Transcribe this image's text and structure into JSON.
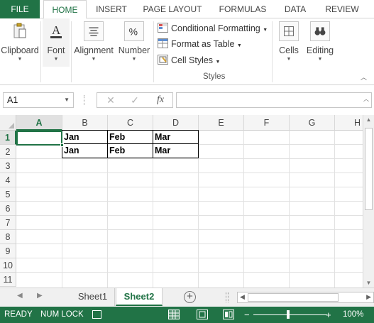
{
  "ribbon_tabs": [
    "FILE",
    "HOME",
    "INSERT",
    "PAGE LAYOUT",
    "FORMULAS",
    "DATA",
    "REVIEW"
  ],
  "ribbon": {
    "clipboard": "Clipboard",
    "font": "Font",
    "alignment": "Alignment",
    "number": "Number",
    "conditional_formatting": "Conditional Formatting",
    "format_as_table": "Format as Table",
    "cell_styles": "Cell Styles",
    "styles_group": "Styles",
    "cells": "Cells",
    "editing": "Editing"
  },
  "formula_bar": {
    "name_box": "A1",
    "cancel": "✕",
    "enter": "✓",
    "function": "fx",
    "value": ""
  },
  "grid": {
    "columns": [
      "A",
      "B",
      "C",
      "D",
      "E",
      "F",
      "G",
      "H"
    ],
    "rows": [
      "1",
      "2",
      "3",
      "4",
      "5",
      "6",
      "7",
      "8",
      "9",
      "10",
      "11"
    ],
    "selected_cell": "A1",
    "cells": {
      "B1": "Jan",
      "C1": "Feb",
      "D1": "Mar",
      "B2": "Jan",
      "C2": "Feb",
      "D2": "Mar"
    }
  },
  "sheets": [
    "Sheet1",
    "Sheet2"
  ],
  "active_sheet": "Sheet2",
  "status": {
    "ready": "READY",
    "num_lock": "NUM LOCK",
    "zoom": "100%",
    "zoom_minus": "−",
    "zoom_plus": "+"
  },
  "colors": {
    "accent": "#217346"
  }
}
